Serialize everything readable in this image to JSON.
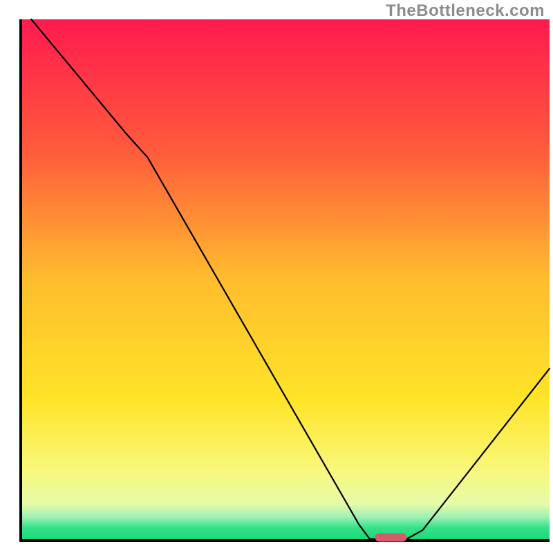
{
  "watermark": "TheBottleneck.com",
  "chart_data": {
    "type": "line",
    "title": "",
    "xlabel": "",
    "ylabel": "",
    "xlim": [
      0,
      100
    ],
    "ylim": [
      0,
      100
    ],
    "grid": false,
    "axes": {
      "left": true,
      "bottom": true,
      "color": "#000000",
      "width": 4
    },
    "background_gradient": {
      "type": "vertical",
      "stops": [
        {
          "pos": 0.0,
          "color": "#ff1a4f"
        },
        {
          "pos": 0.25,
          "color": "#ff5a3c"
        },
        {
          "pos": 0.5,
          "color": "#ffbd2e"
        },
        {
          "pos": 0.73,
          "color": "#ffe428"
        },
        {
          "pos": 0.86,
          "color": "#f9f778"
        },
        {
          "pos": 0.93,
          "color": "#e6fba8"
        },
        {
          "pos": 0.955,
          "color": "#9ff0b4"
        },
        {
          "pos": 0.975,
          "color": "#35e28a"
        },
        {
          "pos": 1.0,
          "color": "#17d977"
        }
      ]
    },
    "series": [
      {
        "name": "bottleneck-curve",
        "color": "#000000",
        "width": 2.2,
        "points": [
          {
            "x": 2.0,
            "y": 100.0
          },
          {
            "x": 20.0,
            "y": 78.0
          },
          {
            "x": 24.0,
            "y": 73.5
          },
          {
            "x": 64.0,
            "y": 3.0
          },
          {
            "x": 66.0,
            "y": 0.3
          },
          {
            "x": 73.0,
            "y": 0.3
          },
          {
            "x": 76.0,
            "y": 2.0
          },
          {
            "x": 100.0,
            "y": 33.0
          }
        ]
      }
    ],
    "markers": [
      {
        "name": "optimal-marker",
        "shape": "rounded-rect",
        "color": "#d95a6a",
        "x_center": 70.0,
        "y": 0.6,
        "width_pct": 6.0,
        "height_pct": 1.6
      }
    ]
  }
}
